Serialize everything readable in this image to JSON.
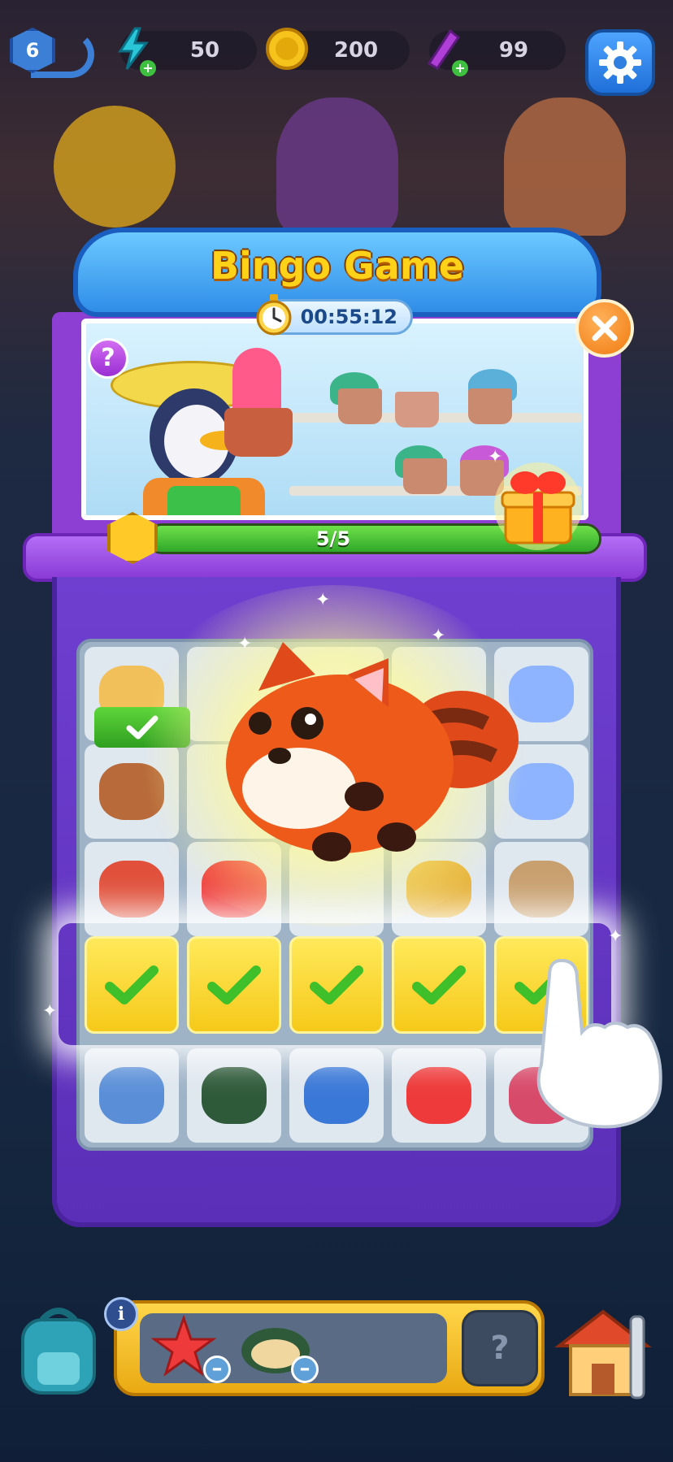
{
  "hud": {
    "level": "6",
    "energy": "50",
    "coins": "200",
    "gems": "99",
    "plus_symbol": "+"
  },
  "bingo": {
    "title": "Bingo Game",
    "timer": "00:55:12",
    "progress_text": "5/5",
    "progress_fraction": 1.0,
    "help_label": "?",
    "close_label": "×"
  },
  "board": {
    "rows": [
      [
        "pizza-pan",
        "",
        "",
        "",
        "ring"
      ],
      [
        "clay-pot",
        "",
        "",
        "",
        "ring"
      ],
      [
        "crab",
        "starfish",
        "",
        "teapot",
        "coin-plate"
      ],
      [
        "checked",
        "checked",
        "checked",
        "checked",
        "checked"
      ],
      [
        "boat",
        "mussel",
        "blue-vase",
        "starfish",
        "mixer"
      ]
    ],
    "completed_row": 3
  },
  "bottom": {
    "info_label": "i",
    "slot_label": "?",
    "minus_symbol": "–"
  },
  "colors": {
    "accent_yellow": "#ffd21a",
    "panel_purple": "#6f3fd0",
    "progress_green": "#2fa82a"
  }
}
